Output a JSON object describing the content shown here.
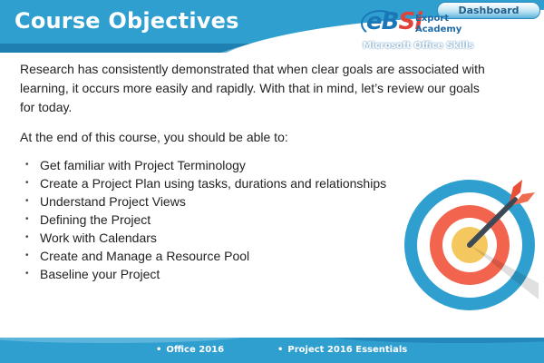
{
  "header": {
    "title": "Course Objectives",
    "dashboard_label": "Dashboard"
  },
  "logo": {
    "mark_e": "e",
    "mark_b": "B",
    "mark_si": "Si",
    "line1": "Export",
    "line2": "Academy",
    "subtitle": "Microsoft Office Skills"
  },
  "main": {
    "intro": "Research has consistently demonstrated that when clear goals are associated with learning, it occurs more easily and rapidly. With that in mind, let’s review our goals for today.",
    "lead": "At the end of this course, you should be able to:",
    "bullet_glyph": "•",
    "objectives": [
      "Get familiar with Project Terminology",
      "Create a Project Plan using tasks, durations and relationships",
      "Understand Project Views",
      "Defining the Project",
      "Work with Calendars",
      "Create and Manage a Resource Pool",
      "Baseline your Project"
    ]
  },
  "footer": {
    "items": [
      "Office 2016",
      "Project 2016 Essentials"
    ]
  },
  "colors": {
    "header_blue": "#2f9fd0",
    "target_blue": "#2f9fd0",
    "target_red": "#f2644e",
    "target_yellow": "#f5c75f"
  },
  "icons": {
    "target": "bullseye-target-icon",
    "arrow": "dart-arrow-icon"
  }
}
